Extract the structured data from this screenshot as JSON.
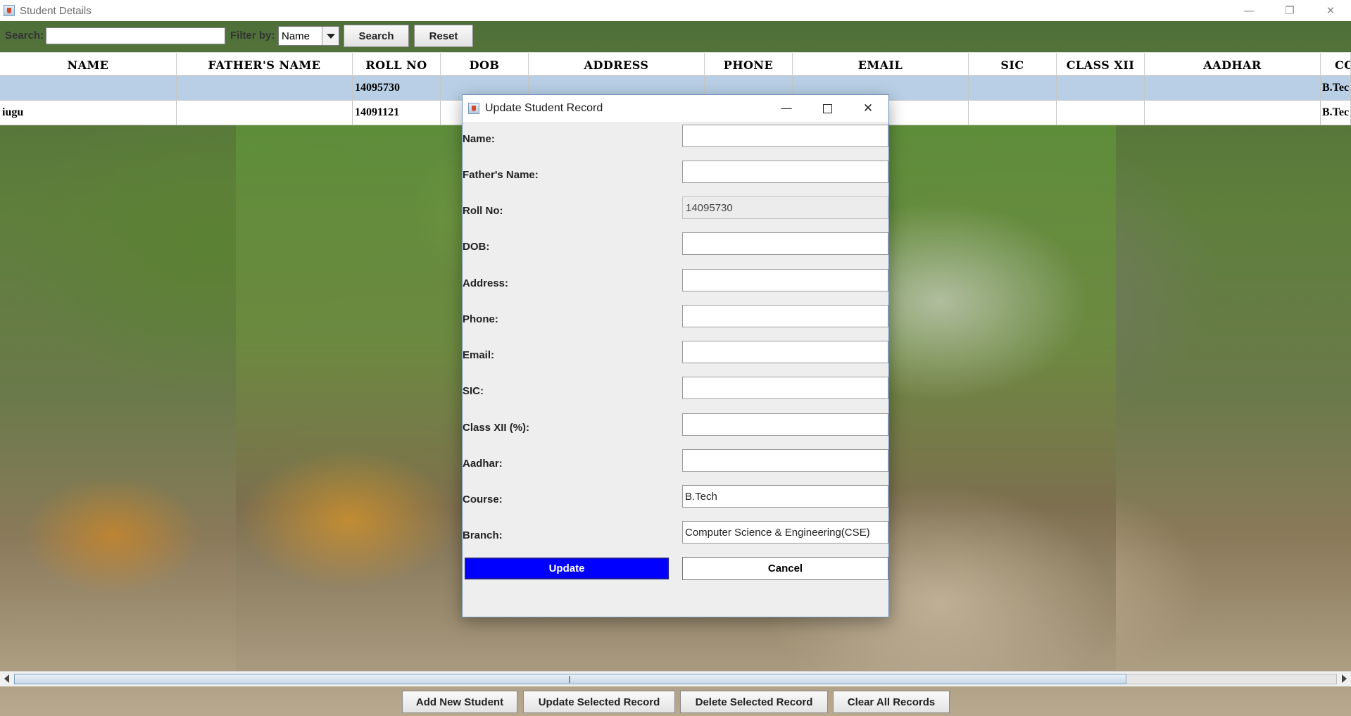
{
  "window": {
    "title": "Student Details",
    "controls": {
      "minimize": "—",
      "maximize": "❐",
      "close": "✕"
    }
  },
  "toolbar": {
    "search_label": "Search:",
    "search_value": "",
    "filter_label": "Filter by:",
    "filter_selected": "Name",
    "search_button": "Search",
    "reset_button": "Reset"
  },
  "table": {
    "columns": [
      "NAME",
      "FATHER'S NAME",
      "ROLL NO",
      "DOB",
      "ADDRESS",
      "PHONE",
      "EMAIL",
      "SIC",
      "CLASS XII",
      "AADHAR",
      "CO"
    ],
    "rows": [
      {
        "name": "",
        "father": "",
        "roll": "14095730",
        "dob": "",
        "address": "",
        "phone": "",
        "email": "",
        "sic": "",
        "class12": "",
        "aadhar": "",
        "course": "B.Tec",
        "selected": true
      },
      {
        "name": "iugu",
        "father": "",
        "roll": "14091121",
        "dob": "",
        "address": "",
        "phone": "",
        "email": "",
        "sic": "",
        "class12": "",
        "aadhar": "",
        "course": "B.Tec",
        "selected": false
      }
    ]
  },
  "bottom": {
    "add": "Add New Student",
    "update": "Update Selected Record",
    "delete": "Delete Selected Record",
    "clear": "Clear All Records"
  },
  "dialog": {
    "title": "Update Student Record",
    "controls": {
      "minimize": "—",
      "close": "✕"
    },
    "fields": [
      {
        "label": "Name:",
        "value": ""
      },
      {
        "label": "Father's Name:",
        "value": ""
      },
      {
        "label": "Roll No:",
        "value": "14095730",
        "disabled": true
      },
      {
        "label": "DOB:",
        "value": ""
      },
      {
        "label": "Address:",
        "value": ""
      },
      {
        "label": "Phone:",
        "value": ""
      },
      {
        "label": "Email:",
        "value": ""
      },
      {
        "label": "SIC:",
        "value": ""
      },
      {
        "label": "Class XII (%):",
        "value": ""
      },
      {
        "label": "Aadhar:",
        "value": ""
      },
      {
        "label": "Course:",
        "value": "B.Tech"
      },
      {
        "label": "Branch:",
        "value": "Computer Science & Engineering(CSE)"
      }
    ],
    "update_button": "Update",
    "cancel_button": "Cancel"
  },
  "colors": {
    "selected_row": "#b8cfe5",
    "update_button": "#0000ff"
  }
}
